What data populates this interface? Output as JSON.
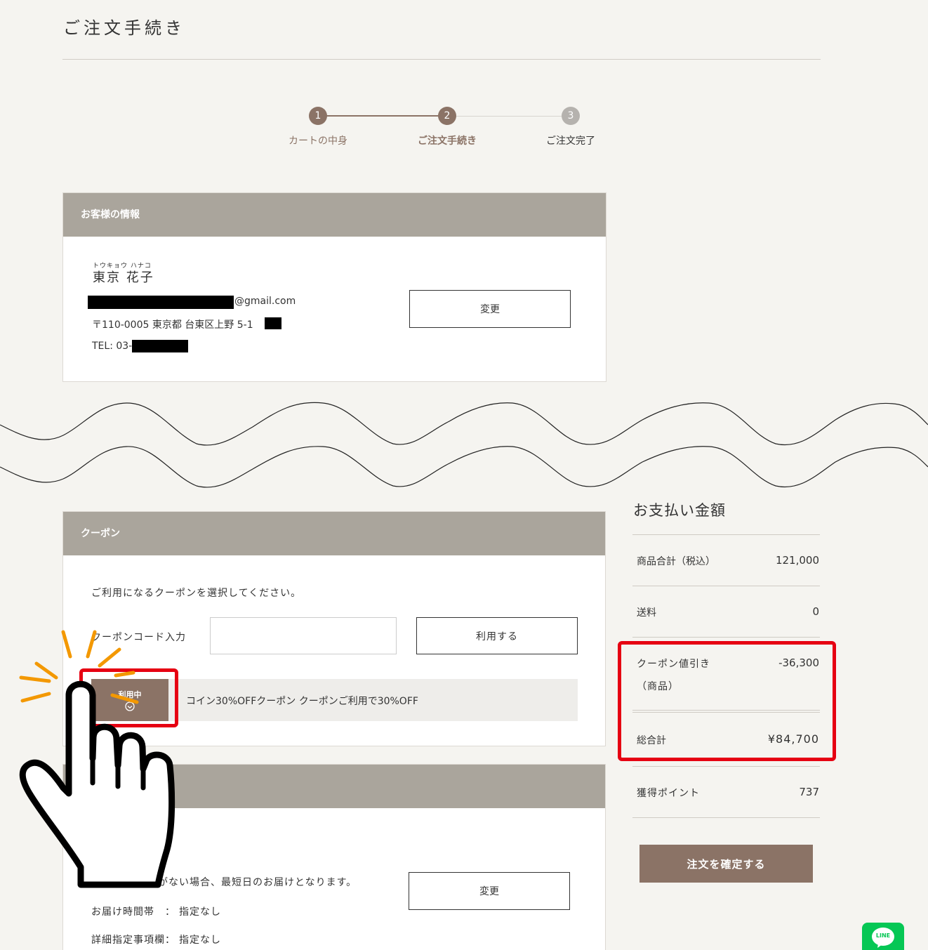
{
  "page": {
    "title": "ご注文手続き"
  },
  "stepper": {
    "steps": [
      {
        "number": "1",
        "label": "カートの中身",
        "state": "done"
      },
      {
        "number": "2",
        "label": "ご注文手続き",
        "state": "current"
      },
      {
        "number": "3",
        "label": "ご注文完了",
        "state": "todo"
      }
    ]
  },
  "customer": {
    "header": "お客様の情報",
    "name_ruby": "トウキョウ ハナコ",
    "name": "東京 花子",
    "email_suffix": "@gmail.com",
    "address": "〒110-0005 東京都 台東区上野 5-1",
    "tel_prefix": "TEL: 03-",
    "change_label": "変更"
  },
  "coupon": {
    "header": "クーポン",
    "instruction": "ご利用になるクーポンを選択してください。",
    "code_label": "クーポンコード入力",
    "code_value": "",
    "apply_label": "利用する",
    "in_use_label": "利用中",
    "coupon_text": "コイン30%OFFクーポン クーポンご利用で30%OFF"
  },
  "delivery": {
    "note_partial": "がない場合、最短日のお届けとなります。",
    "time_label": "お届け時間帯　：",
    "time_value": "指定なし",
    "detail_label": "詳細指定事項欄：",
    "detail_value": "指定なし",
    "change_label": "変更"
  },
  "summary": {
    "title": "お支払い金額",
    "subtotal_label": "商品合計（税込）",
    "subtotal_value": "121,000",
    "shipping_label": "送料",
    "shipping_value": "0",
    "coupon_label_1": "クーポン値引き",
    "coupon_label_2": "（商品）",
    "coupon_value": "-36,300",
    "total_label": "総合計",
    "total_value": "¥84,700",
    "points_label": "獲得ポイント",
    "points_value": "737",
    "confirm_label": "注文を確定する"
  },
  "line_badge": {
    "label": "LINE"
  },
  "colors": {
    "background": "#f5f4f0",
    "panel_header": "#aaa59c",
    "accent_brown": "#8b7366",
    "highlight_red": "#e60012",
    "line_green": "#06c755"
  }
}
